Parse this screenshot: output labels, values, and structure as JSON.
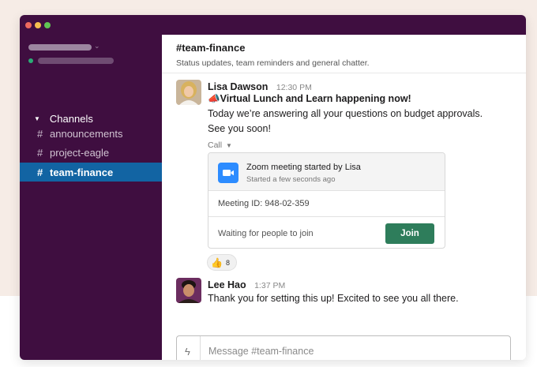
{
  "sidebar": {
    "section_label": "Channels",
    "channels": [
      {
        "hash": "#",
        "name": "announcements"
      },
      {
        "hash": "#",
        "name": "project-eagle"
      },
      {
        "hash": "#",
        "name": "team-finance"
      }
    ],
    "active_channel": "team-finance"
  },
  "channel": {
    "title": "#team-finance",
    "topic": "Status updates, team reminders and general chatter."
  },
  "messages": [
    {
      "author": "Lisa Dawson",
      "time": "12:30 PM",
      "lines": [
        "Virtual Lunch and Learn happening now!",
        "Today we’re answering all your questions on budget approvals.",
        "See you soon!"
      ],
      "lead_emoji": "📣",
      "call": {
        "label": "Call",
        "title": "Zoom meeting started by Lisa",
        "subtitle": "Started a few seconds ago",
        "meeting_id": "Meeting ID: 948-02-359",
        "status": "Waiting for people to join",
        "join_label": "Join"
      },
      "reaction": {
        "emoji": "👍",
        "count": "8"
      }
    },
    {
      "author": "Lee Hao",
      "time": "1:37 PM",
      "lines": [
        "Thank you for setting this up! Excited to see you all there."
      ]
    }
  ],
  "composer": {
    "placeholder": "Message #team-finance"
  },
  "colors": {
    "sidebar_bg": "#3f0e40",
    "active_channel_bg": "#1264a3",
    "join_button_bg": "#2e7d5b",
    "zoom_blue": "#2d8cff"
  }
}
